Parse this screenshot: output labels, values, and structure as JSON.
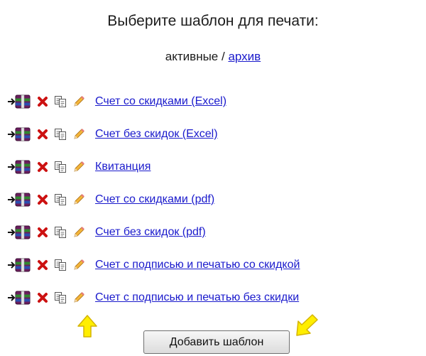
{
  "page": {
    "title": "Выберите шаблон для печати:",
    "filter": {
      "active_label": "активные",
      "separator": " / ",
      "archive_label": "архив"
    }
  },
  "templates": [
    {
      "name": "Счет со скидками (Excel)"
    },
    {
      "name": "Счет без скидок (Excel)"
    },
    {
      "name": "Квитанция"
    },
    {
      "name": "Счет со скидками (pdf)"
    },
    {
      "name": "Счет без скидок (pdf)"
    },
    {
      "name": "Счет с подписью и печатью со скидкой"
    },
    {
      "name": "Счет с подписью и печатью без скидки"
    }
  ],
  "row_icons": [
    "archive-move-icon",
    "delete-icon",
    "copy-icon",
    "edit-icon"
  ],
  "add_button_label": "Добавить шаблон",
  "colors": {
    "link": "#1a1acc",
    "delete": "#cc1111",
    "arrow": "#ffee00",
    "arrow_outline": "#d4b300"
  }
}
